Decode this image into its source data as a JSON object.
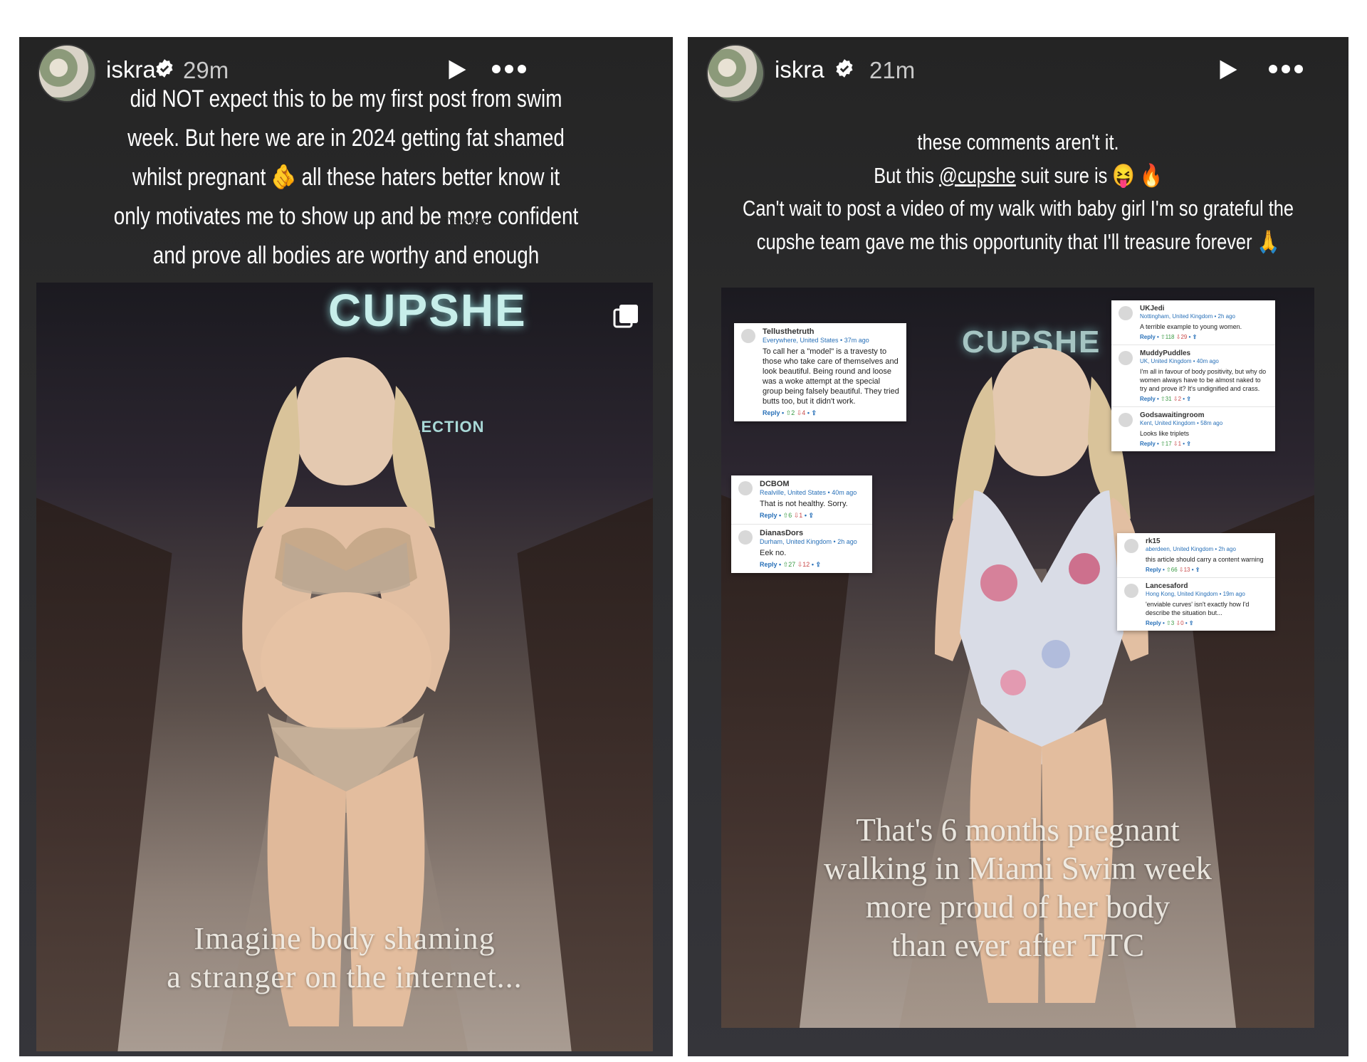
{
  "stories": [
    {
      "username": "iskra",
      "time_ago": "29m",
      "caption_lines": [
        "did NOT expect this to be my first post from swim",
        "week. But here we are in 2024 getting fat shamed",
        "whilst pregnant 🫵 all these haters better know it",
        "only motivates me to show up and be more confident",
        "and prove all bodies are worthy and enough"
      ],
      "watermark": "TVNew.Com",
      "brand": "CUPSHE",
      "subbrand": "RED COLLECTION",
      "overlay_lines": [
        "Imagine body shaming",
        "a stranger on the internet..."
      ]
    },
    {
      "username": "iskra",
      "time_ago": "21m",
      "caption_line1": "these comments aren't it.",
      "caption_line2_pre": "But this ",
      "caption_mention": "@cupshe",
      "caption_line2_post": " suit sure is 😝 🔥",
      "caption_line3": "Can't wait to post a video of my walk with baby girl I'm so grateful the",
      "caption_line4": "cupshe team gave me this opportunity that I'll treasure forever 🙏",
      "brand": "CUPSHE",
      "overlay_lines": [
        "That's 6 months pregnant",
        "walking in Miami Swim week",
        "more proud of her body",
        "than ever after TTC"
      ],
      "comment_cards": [
        {
          "comments": [
            {
              "user": "Tellusthetruth",
              "meta": "Everywhere, United States • 37m ago",
              "text": "To call her a \"model\" is a travesty to those who take care of themselves and look beautiful. Being round and loose was a woke attempt at the special group being falsely beautiful. They tried butts too, but it didn't work.",
              "up": "2",
              "down": "4"
            }
          ]
        },
        {
          "comments": [
            {
              "user": "DCBOM",
              "meta": "Realville, United States • 40m ago",
              "text": "That is not healthy. Sorry.",
              "up": "6",
              "down": "1"
            },
            {
              "user": "DianasDors",
              "meta": "Durham, United Kingdom • 2h ago",
              "text": "Eek no.",
              "up": "27",
              "down": "12"
            }
          ]
        },
        {
          "comments": [
            {
              "user": "UKJedi",
              "meta": "Nottingham, United Kingdom • 2h ago",
              "text": "A terrible example to young women.",
              "up": "118",
              "down": "29"
            },
            {
              "user": "MuddyPuddles",
              "meta": "UK, United Kingdom • 40m ago",
              "text": "I'm all in favour of body positivity, but why do women always have to be almost naked to try and prove it? It's undignified and crass.",
              "up": "31",
              "down": "2"
            },
            {
              "user": "Godsawaitingroom",
              "meta": "Kent, United Kingdom • 58m ago",
              "text": "Looks like triplets",
              "up": "17",
              "down": "1"
            }
          ]
        },
        {
          "comments": [
            {
              "user": "rk15",
              "meta": "aberdeen, United Kingdom • 2h ago",
              "text": "this article should carry a content warning",
              "up": "66",
              "down": "13"
            },
            {
              "user": "Lancesaford",
              "meta": "Hong Kong, United Kingdom • 19m ago",
              "text": "'enviable curves' isn't exactly how I'd describe the situation but...",
              "up": "3",
              "down": "0"
            }
          ]
        }
      ]
    }
  ],
  "labels": {
    "reply": "Reply"
  }
}
